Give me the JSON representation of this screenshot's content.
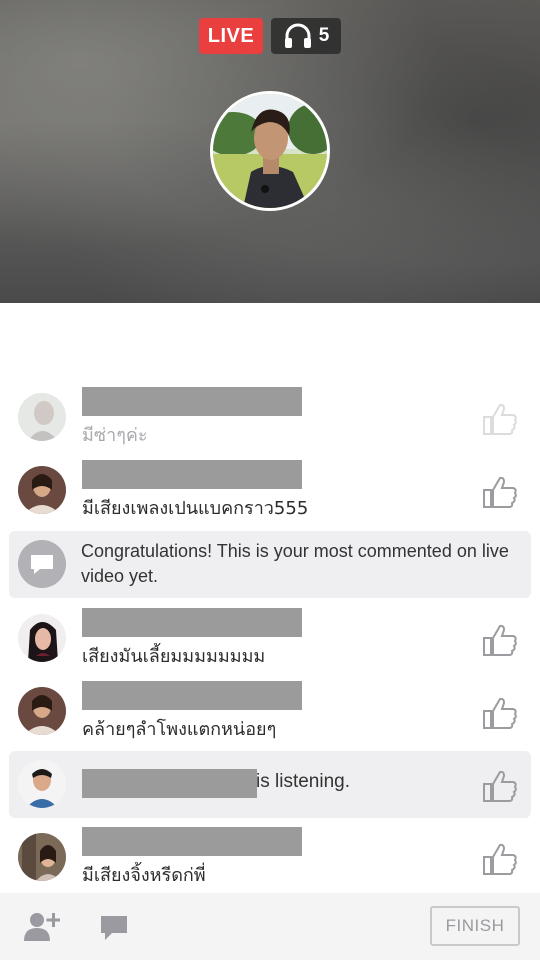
{
  "header": {
    "live_label": "LIVE",
    "listener_count": "5"
  },
  "comments": [
    {
      "text": "มีซ่าๆค่ะ",
      "faded": true
    },
    {
      "text": "มีเสียงเพลงเปนแบคกราว555"
    },
    {
      "notice": "Congratulations! This is your most commented on live video yet."
    },
    {
      "text": "เสียงมันเลี้ยมมมมมมมม"
    },
    {
      "text": "คล้ายๆลำโพงแตกหน่อยๆ"
    },
    {
      "listening": "is listening."
    },
    {
      "text": "มีเสียงจิ้งหรีดก่พี่"
    }
  ],
  "footer": {
    "finish_label": "FINISH"
  },
  "colors": {
    "live_red": "#e9403f",
    "notice_bg": "#efeff1"
  },
  "icons": [
    "headphones-icon",
    "like-icon",
    "chat-bubble-icon",
    "add-friend-icon",
    "comment-icon"
  ]
}
